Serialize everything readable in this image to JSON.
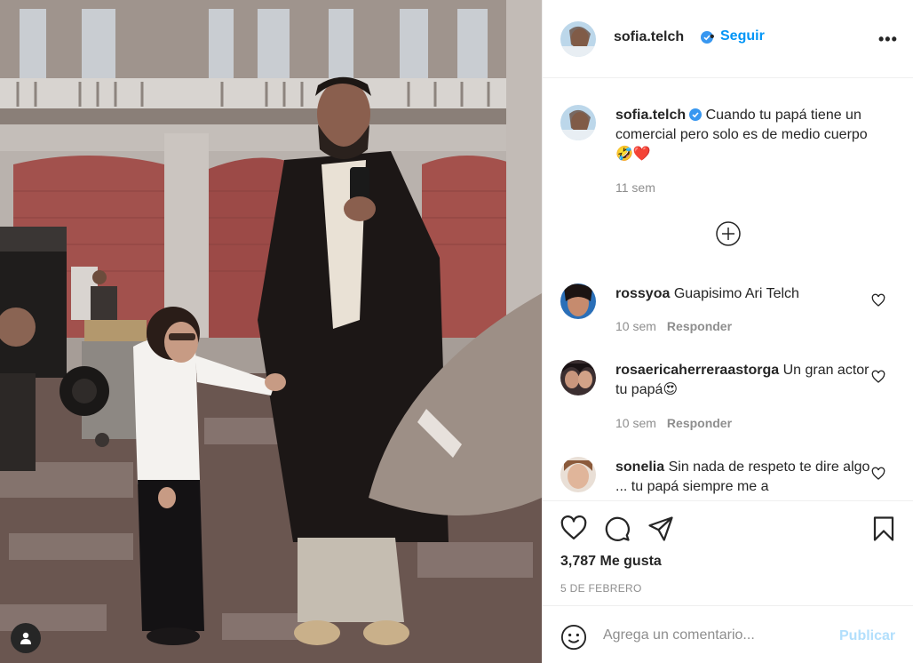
{
  "post": {
    "username": "sofia.telch",
    "follow_label": "Seguir",
    "separator": "•",
    "more_label": "•••"
  },
  "caption": {
    "username": "sofia.telch",
    "text": "Cuando tu papá tiene un comercial pero solo es de medio cuerpo",
    "emojis": "🤣❤️",
    "time": "11 sem"
  },
  "comments": [
    {
      "username": "rossyoa",
      "text": "Guapisimo Ari Telch",
      "time": "10 sem",
      "reply_label": "Responder"
    },
    {
      "username": "rosaericaherreraastorga",
      "text": "Un gran actor tu papá",
      "emoji": "😍",
      "time": "10 sem",
      "reply_label": "Responder"
    },
    {
      "username": "sonelia",
      "text": "Sin nada de respeto te dire algo ... tu papá siempre me a",
      "time": "",
      "reply_label": ""
    }
  ],
  "stats": {
    "likes": "3,787 Me gusta",
    "date": "5 DE FEBRERO"
  },
  "composer": {
    "placeholder": "Agrega un comentario...",
    "publish_label": "Publicar"
  },
  "colors": {
    "accent": "#0095f6",
    "text": "#262626",
    "muted": "#8e8e8e",
    "publish_disabled": "#b2dffc"
  }
}
